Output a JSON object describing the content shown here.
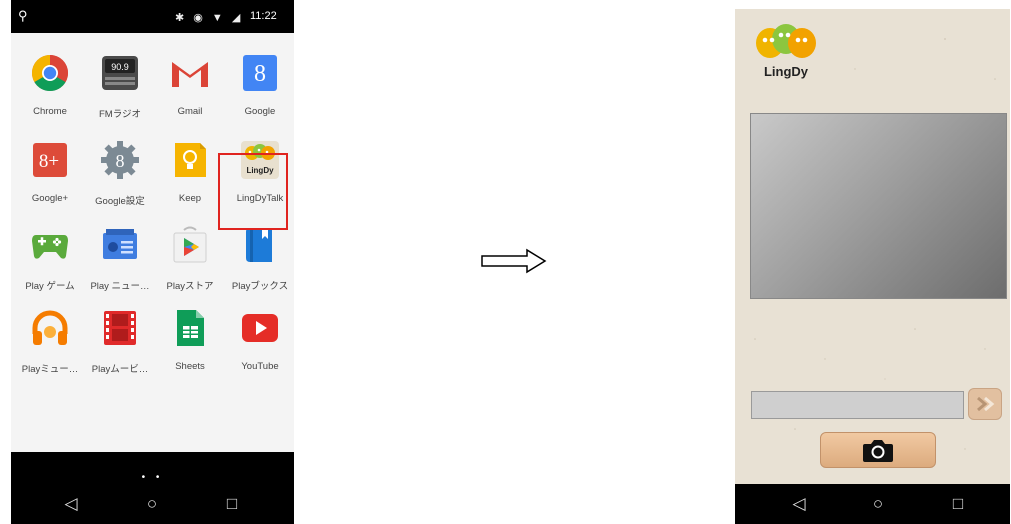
{
  "left_phone": {
    "status_bar": {
      "time": "11:22"
    },
    "apps": [
      {
        "label": "Chrome",
        "icon": "chrome-icon"
      },
      {
        "label": "FMラジオ",
        "icon": "fm-radio-icon",
        "badge": "90.9"
      },
      {
        "label": "Gmail",
        "icon": "gmail-icon"
      },
      {
        "label": "Google",
        "icon": "google-icon",
        "glyph": "8"
      },
      {
        "label": "Google+",
        "icon": "google-plus-icon",
        "glyph": "8+"
      },
      {
        "label": "Google設定",
        "icon": "google-settings-icon",
        "glyph": "8"
      },
      {
        "label": "Keep",
        "icon": "keep-icon"
      },
      {
        "label": "LingDyTalk",
        "icon": "lingdy-icon",
        "glyph": "LingDy"
      },
      {
        "label": "Play ゲーム",
        "icon": "play-games-icon"
      },
      {
        "label": "Play ニュー…",
        "icon": "play-news-icon"
      },
      {
        "label": "Playストア",
        "icon": "play-store-icon"
      },
      {
        "label": "Playブックス",
        "icon": "play-books-icon"
      },
      {
        "label": "Playミュー…",
        "icon": "play-music-icon"
      },
      {
        "label": "Playムービ…",
        "icon": "play-movies-icon"
      },
      {
        "label": "Sheets",
        "icon": "sheets-icon"
      },
      {
        "label": "YouTube",
        "icon": "youtube-icon"
      }
    ],
    "page_dots": "• •",
    "nav": {
      "back": "◁",
      "home": "○",
      "recents": "□"
    }
  },
  "arrow": "arrow-right-icon",
  "right_phone": {
    "logo_text": "LingDy",
    "nav": {
      "back": "◁",
      "home": "○",
      "recents": "□"
    }
  },
  "colors": {
    "highlight": "#e0241f",
    "beige_background": "#e8e1d4",
    "button": "#dcab7e"
  }
}
